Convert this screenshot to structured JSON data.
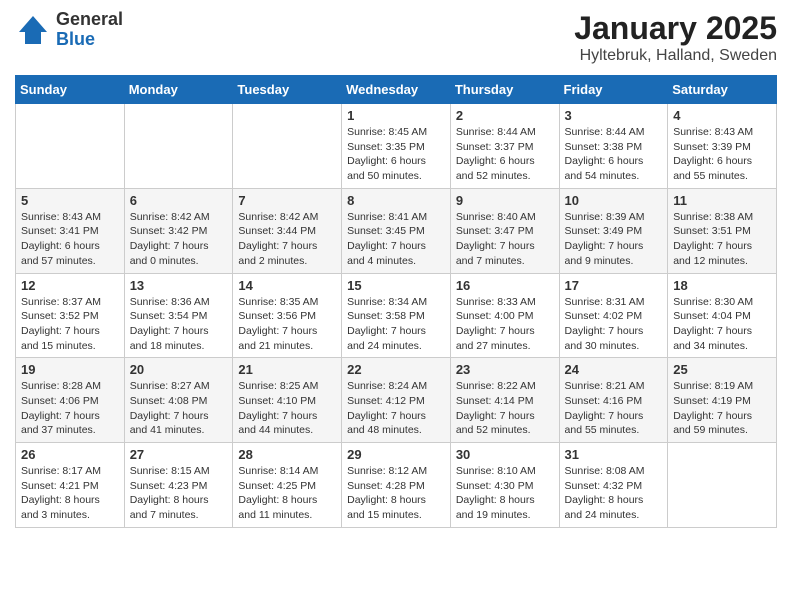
{
  "header": {
    "logo_general": "General",
    "logo_blue": "Blue",
    "title": "January 2025",
    "location": "Hyltebruk, Halland, Sweden"
  },
  "days_of_week": [
    "Sunday",
    "Monday",
    "Tuesday",
    "Wednesday",
    "Thursday",
    "Friday",
    "Saturday"
  ],
  "weeks": [
    [
      {
        "day": "",
        "info": ""
      },
      {
        "day": "",
        "info": ""
      },
      {
        "day": "",
        "info": ""
      },
      {
        "day": "1",
        "info": "Sunrise: 8:45 AM\nSunset: 3:35 PM\nDaylight: 6 hours\nand 50 minutes."
      },
      {
        "day": "2",
        "info": "Sunrise: 8:44 AM\nSunset: 3:37 PM\nDaylight: 6 hours\nand 52 minutes."
      },
      {
        "day": "3",
        "info": "Sunrise: 8:44 AM\nSunset: 3:38 PM\nDaylight: 6 hours\nand 54 minutes."
      },
      {
        "day": "4",
        "info": "Sunrise: 8:43 AM\nSunset: 3:39 PM\nDaylight: 6 hours\nand 55 minutes."
      }
    ],
    [
      {
        "day": "5",
        "info": "Sunrise: 8:43 AM\nSunset: 3:41 PM\nDaylight: 6 hours\nand 57 minutes."
      },
      {
        "day": "6",
        "info": "Sunrise: 8:42 AM\nSunset: 3:42 PM\nDaylight: 7 hours\nand 0 minutes."
      },
      {
        "day": "7",
        "info": "Sunrise: 8:42 AM\nSunset: 3:44 PM\nDaylight: 7 hours\nand 2 minutes."
      },
      {
        "day": "8",
        "info": "Sunrise: 8:41 AM\nSunset: 3:45 PM\nDaylight: 7 hours\nand 4 minutes."
      },
      {
        "day": "9",
        "info": "Sunrise: 8:40 AM\nSunset: 3:47 PM\nDaylight: 7 hours\nand 7 minutes."
      },
      {
        "day": "10",
        "info": "Sunrise: 8:39 AM\nSunset: 3:49 PM\nDaylight: 7 hours\nand 9 minutes."
      },
      {
        "day": "11",
        "info": "Sunrise: 8:38 AM\nSunset: 3:51 PM\nDaylight: 7 hours\nand 12 minutes."
      }
    ],
    [
      {
        "day": "12",
        "info": "Sunrise: 8:37 AM\nSunset: 3:52 PM\nDaylight: 7 hours\nand 15 minutes."
      },
      {
        "day": "13",
        "info": "Sunrise: 8:36 AM\nSunset: 3:54 PM\nDaylight: 7 hours\nand 18 minutes."
      },
      {
        "day": "14",
        "info": "Sunrise: 8:35 AM\nSunset: 3:56 PM\nDaylight: 7 hours\nand 21 minutes."
      },
      {
        "day": "15",
        "info": "Sunrise: 8:34 AM\nSunset: 3:58 PM\nDaylight: 7 hours\nand 24 minutes."
      },
      {
        "day": "16",
        "info": "Sunrise: 8:33 AM\nSunset: 4:00 PM\nDaylight: 7 hours\nand 27 minutes."
      },
      {
        "day": "17",
        "info": "Sunrise: 8:31 AM\nSunset: 4:02 PM\nDaylight: 7 hours\nand 30 minutes."
      },
      {
        "day": "18",
        "info": "Sunrise: 8:30 AM\nSunset: 4:04 PM\nDaylight: 7 hours\nand 34 minutes."
      }
    ],
    [
      {
        "day": "19",
        "info": "Sunrise: 8:28 AM\nSunset: 4:06 PM\nDaylight: 7 hours\nand 37 minutes."
      },
      {
        "day": "20",
        "info": "Sunrise: 8:27 AM\nSunset: 4:08 PM\nDaylight: 7 hours\nand 41 minutes."
      },
      {
        "day": "21",
        "info": "Sunrise: 8:25 AM\nSunset: 4:10 PM\nDaylight: 7 hours\nand 44 minutes."
      },
      {
        "day": "22",
        "info": "Sunrise: 8:24 AM\nSunset: 4:12 PM\nDaylight: 7 hours\nand 48 minutes."
      },
      {
        "day": "23",
        "info": "Sunrise: 8:22 AM\nSunset: 4:14 PM\nDaylight: 7 hours\nand 52 minutes."
      },
      {
        "day": "24",
        "info": "Sunrise: 8:21 AM\nSunset: 4:16 PM\nDaylight: 7 hours\nand 55 minutes."
      },
      {
        "day": "25",
        "info": "Sunrise: 8:19 AM\nSunset: 4:19 PM\nDaylight: 7 hours\nand 59 minutes."
      }
    ],
    [
      {
        "day": "26",
        "info": "Sunrise: 8:17 AM\nSunset: 4:21 PM\nDaylight: 8 hours\nand 3 minutes."
      },
      {
        "day": "27",
        "info": "Sunrise: 8:15 AM\nSunset: 4:23 PM\nDaylight: 8 hours\nand 7 minutes."
      },
      {
        "day": "28",
        "info": "Sunrise: 8:14 AM\nSunset: 4:25 PM\nDaylight: 8 hours\nand 11 minutes."
      },
      {
        "day": "29",
        "info": "Sunrise: 8:12 AM\nSunset: 4:28 PM\nDaylight: 8 hours\nand 15 minutes."
      },
      {
        "day": "30",
        "info": "Sunrise: 8:10 AM\nSunset: 4:30 PM\nDaylight: 8 hours\nand 19 minutes."
      },
      {
        "day": "31",
        "info": "Sunrise: 8:08 AM\nSunset: 4:32 PM\nDaylight: 8 hours\nand 24 minutes."
      },
      {
        "day": "",
        "info": ""
      }
    ]
  ]
}
